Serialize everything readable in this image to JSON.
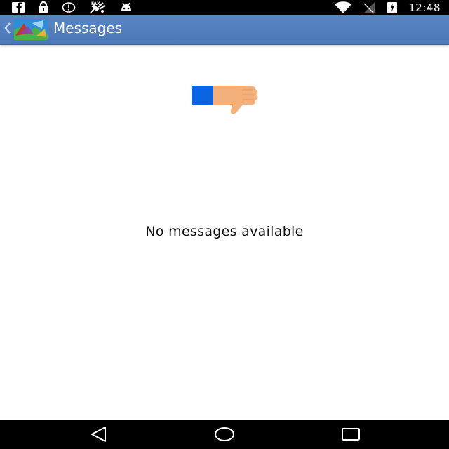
{
  "status_bar": {
    "time": "12:48",
    "left_icons": [
      "facebook-icon",
      "lock-icon",
      "info-circle-icon",
      "fax-satellite-icon",
      "android-icon"
    ],
    "right_icons": [
      "wifi-icon",
      "signal-off-icon",
      "battery-charging-icon"
    ]
  },
  "action_bar": {
    "title": "Messages",
    "background_color": "#4f7cbd"
  },
  "empty_state": {
    "icon": "thumbs-down-icon",
    "text": "No messages available"
  },
  "nav_bar": {
    "buttons": [
      "back-icon",
      "home-icon",
      "recents-icon"
    ]
  }
}
